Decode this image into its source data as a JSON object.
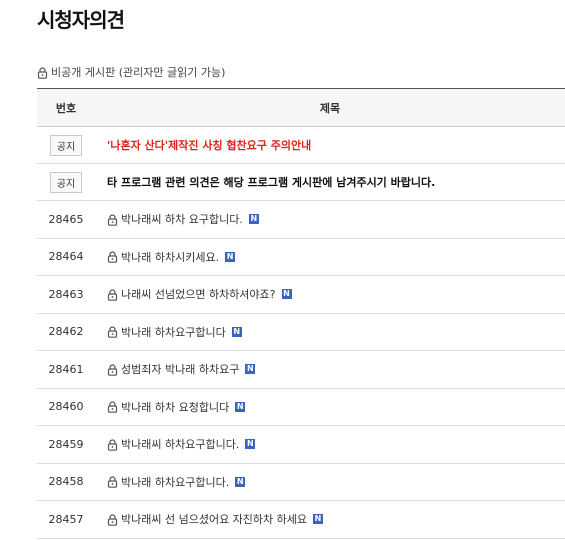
{
  "page": {
    "title": "시청자의견",
    "board_note": "비공개 게시판 (관리자만 글읽기 가능)"
  },
  "table": {
    "headers": {
      "number": "번호",
      "title": "제목"
    },
    "notices": [
      {
        "badge": "공지",
        "title": "'나혼자 산다'제작진 사칭 협찬요구 주의안내",
        "color": "#e0231a"
      },
      {
        "badge": "공지",
        "title": "타 프로그램 관련 의견은 해당 프로그램 게시판에 남겨주시기 바랍니다."
      }
    ],
    "posts": [
      {
        "number": "28465",
        "title": "박나래씨 하차 요구합니다.",
        "new_badge": "N"
      },
      {
        "number": "28464",
        "title": "박나래 하차시키세요.",
        "new_badge": "N"
      },
      {
        "number": "28463",
        "title": "나래씨 선넘었으면 하차하셔야죠?",
        "new_badge": "N"
      },
      {
        "number": "28462",
        "title": "박나래 하차요구합니다",
        "new_badge": "N"
      },
      {
        "number": "28461",
        "title": "성범죄자 박나래 하차요구",
        "new_badge": "N"
      },
      {
        "number": "28460",
        "title": "박나래 하차 요청합니다",
        "new_badge": "N"
      },
      {
        "number": "28459",
        "title": "박나래씨 하차요구합니다.",
        "new_badge": "N"
      },
      {
        "number": "28458",
        "title": "박나래 하차요구합니다.",
        "new_badge": "N"
      },
      {
        "number": "28457",
        "title": "박나래씨 선 넘으셨어요 자진하차 하세요",
        "new_badge": "N"
      }
    ]
  },
  "icons": {
    "lock": "lock-icon",
    "new": "new-badge"
  },
  "colors": {
    "accent_red": "#e0231a",
    "new_badge_blue": "#3b63c4"
  }
}
